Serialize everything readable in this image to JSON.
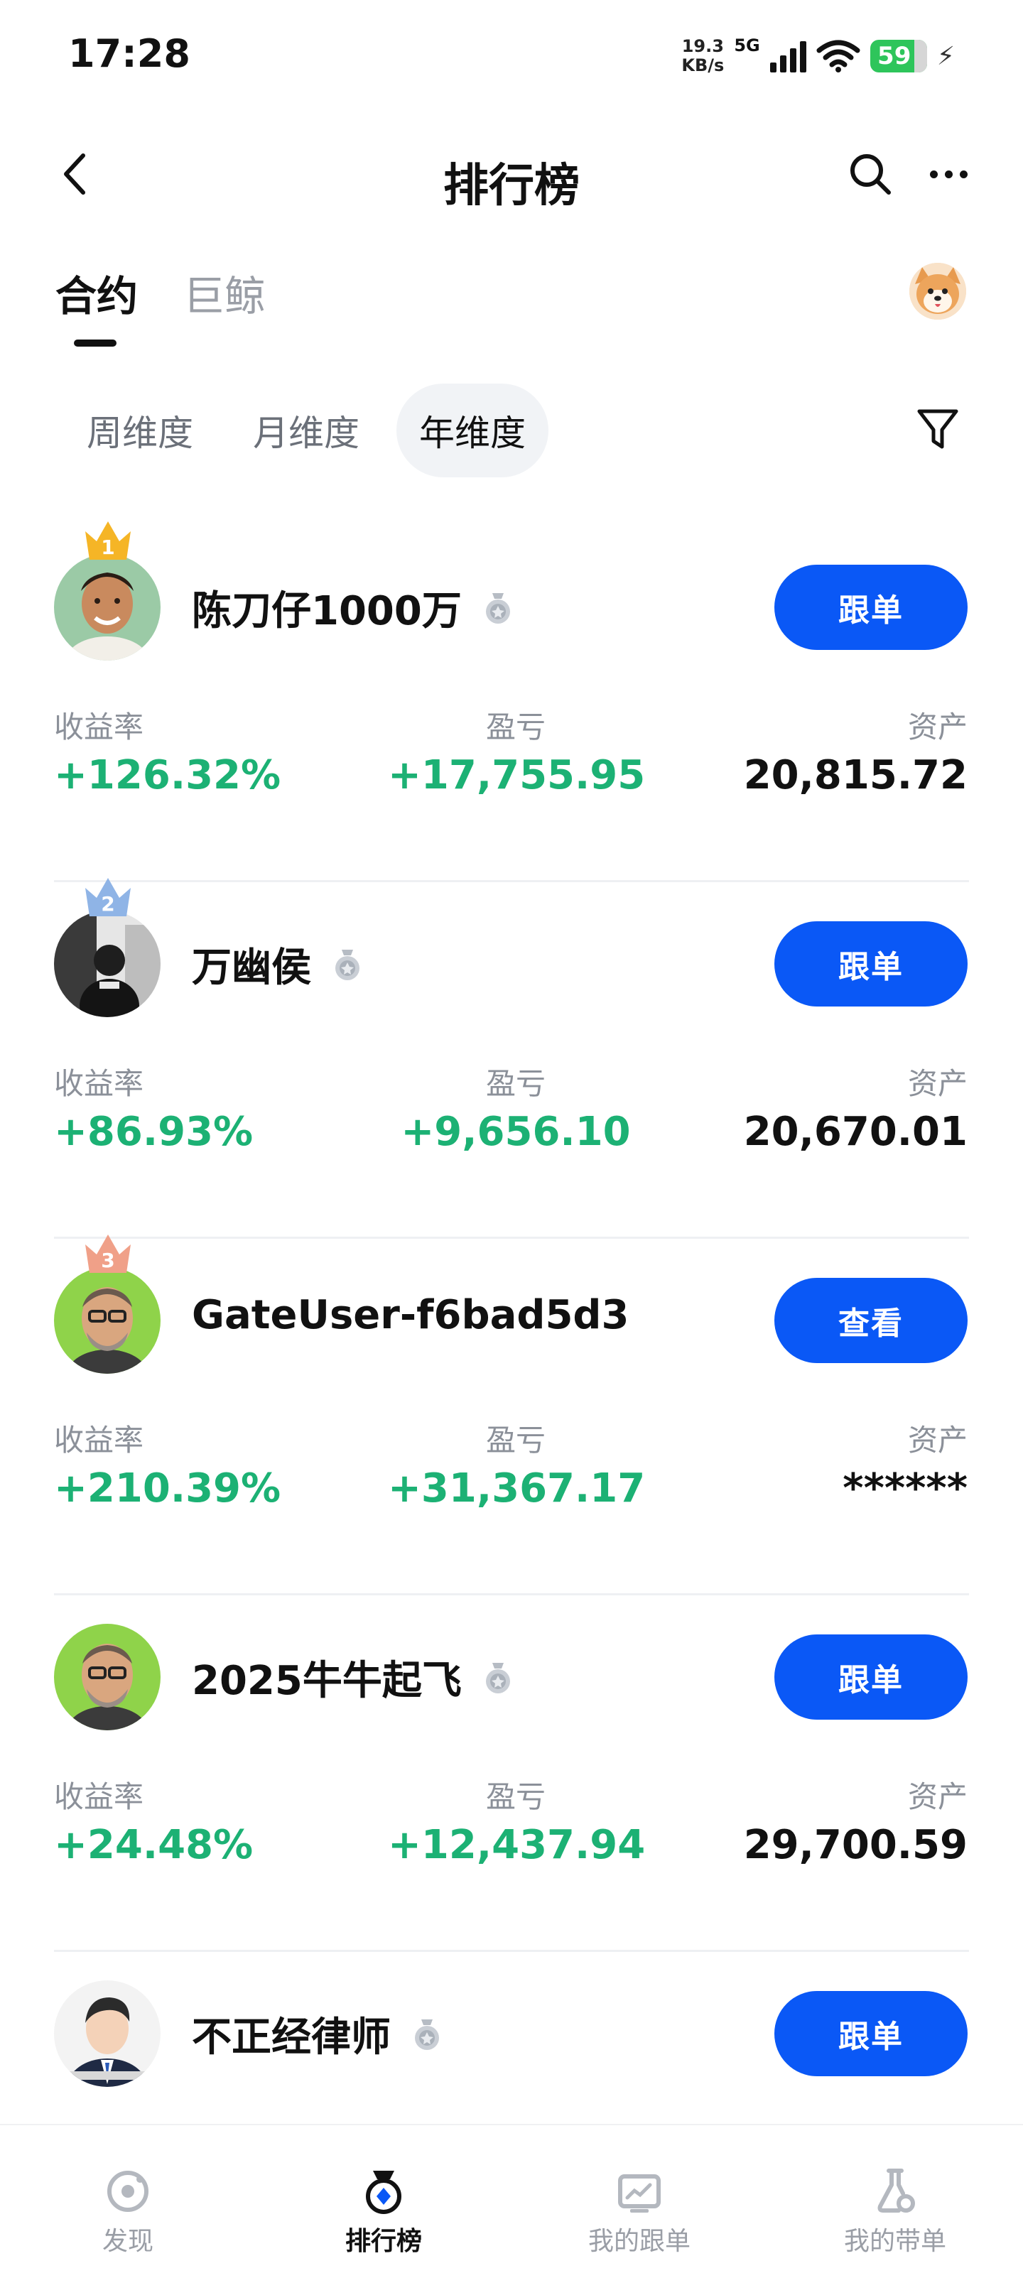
{
  "status_bar": {
    "time": "17:28",
    "net_speed_value": "19.3",
    "net_speed_unit": "KB/s",
    "network": "5G",
    "battery": "59",
    "charging_icon": "bolt-icon"
  },
  "header": {
    "title": "排行榜",
    "back_icon": "chevron-left-icon",
    "search_icon": "search-icon",
    "more_icon": "more-icon"
  },
  "tabs": [
    {
      "label": "合约",
      "active": true
    },
    {
      "label": "巨鲸",
      "active": false
    }
  ],
  "periods": [
    {
      "label": "周维度",
      "active": false
    },
    {
      "label": "月维度",
      "active": false
    },
    {
      "label": "年维度",
      "active": true
    }
  ],
  "stat_labels": {
    "roi": "收益率",
    "pnl": "盈亏",
    "assets": "资产"
  },
  "traders": [
    {
      "rank": "1",
      "name": "陈刀仔1000万",
      "has_medal": true,
      "action": "跟单",
      "roi": "+126.32%",
      "pnl": "+17,755.95",
      "assets": "20,815.72"
    },
    {
      "rank": "2",
      "name": "万幽侯",
      "has_medal": true,
      "action": "跟单",
      "roi": "+86.93%",
      "pnl": "+9,656.10",
      "assets": "20,670.01"
    },
    {
      "rank": "3",
      "name": "GateUser-f6bad5d3",
      "has_medal": false,
      "action": "查看",
      "roi": "+210.39%",
      "pnl": "+31,367.17",
      "assets": "******"
    },
    {
      "rank": "",
      "name": "2025牛牛起飞",
      "has_medal": true,
      "action": "跟单",
      "roi": "+24.48%",
      "pnl": "+12,437.94",
      "assets": "29,700.59"
    },
    {
      "rank": "",
      "name": "不正经律师",
      "has_medal": true,
      "action": "跟单",
      "roi": "",
      "pnl": "",
      "assets": ""
    }
  ],
  "bottom_nav": [
    {
      "label": "发现",
      "icon": "discover-icon",
      "active": false
    },
    {
      "label": "排行榜",
      "icon": "medal-icon",
      "active": true
    },
    {
      "label": "我的跟单",
      "icon": "chart-board-icon",
      "active": false
    },
    {
      "label": "我的带单",
      "icon": "flask-icon",
      "active": false
    }
  ],
  "colors": {
    "accent": "#0a58f6",
    "positive": "#1cb174",
    "gold": "#f5b526",
    "silver": "#8fb4e6",
    "bronze": "#f0a088"
  }
}
